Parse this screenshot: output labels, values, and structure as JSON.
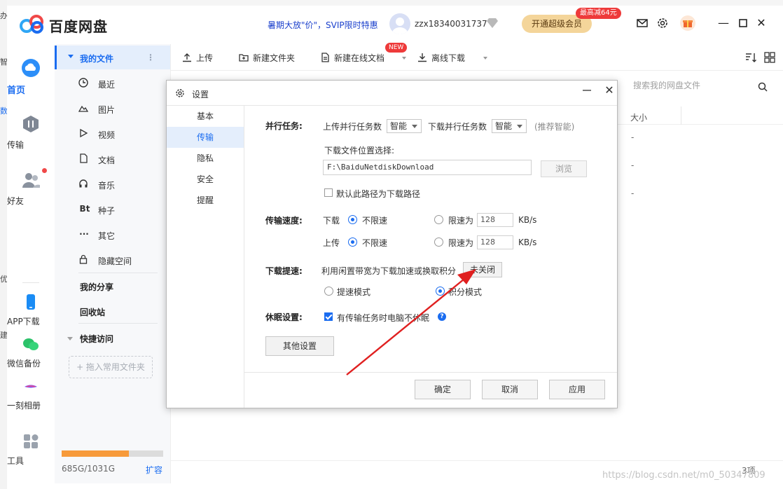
{
  "app": {
    "name": "百度网盘",
    "promo": "暑期大放\"价\"，SVIP限时特惠",
    "username": "zzx18340031737",
    "vip_button": "开通超级会员",
    "vip_badge": "最高减64元"
  },
  "rail": {
    "items": [
      {
        "label": "首页"
      },
      {
        "label": "传输"
      },
      {
        "label": "好友"
      },
      {
        "label": "APP下载"
      },
      {
        "label": "微信备份"
      },
      {
        "label": "一刻相册"
      },
      {
        "label": "工具"
      }
    ]
  },
  "tree": {
    "mine": "我的文件",
    "items": [
      {
        "label": "最近",
        "icon": "clock-icon"
      },
      {
        "label": "图片",
        "icon": "image-icon"
      },
      {
        "label": "视频",
        "icon": "play-icon"
      },
      {
        "label": "文档",
        "icon": "document-icon"
      },
      {
        "label": "音乐",
        "icon": "headphone-icon"
      },
      {
        "label": "种子",
        "icon": "bt-icon",
        "glyph": "Bt"
      },
      {
        "label": "其它",
        "icon": "more-icon",
        "glyph": "···"
      },
      {
        "label": "隐藏空间",
        "icon": "lock-icon"
      }
    ],
    "share": "我的分享",
    "recycle": "回收站",
    "quick_access": "快捷访问",
    "drag_hint": "+ 拖入常用文件夹",
    "storage_text": "685G/1031G",
    "storage_used_fraction": 0.664,
    "expand": "扩容"
  },
  "toolbar": {
    "upload": "上传",
    "new_folder": "新建文件夹",
    "new_doc": "新建在线文档",
    "new_badge": "NEW",
    "offline": "离线下载"
  },
  "main": {
    "search_placeholder": "搜索我的网盘文件",
    "col_size": "大小",
    "rows": [
      "-",
      "-",
      "-"
    ],
    "count": "3项"
  },
  "dialog": {
    "title": "设置",
    "nav": [
      {
        "label": "基本",
        "active": false
      },
      {
        "label": "传输",
        "active": true
      },
      {
        "label": "隐私",
        "active": false
      },
      {
        "label": "安全",
        "active": false
      },
      {
        "label": "提醒",
        "active": false
      }
    ],
    "parallel": {
      "label": "并行任务:",
      "upload_label": "上传并行任务数",
      "upload_value": "智能",
      "download_label": "下载并行任务数",
      "download_value": "智能",
      "hint": "(推荐智能)"
    },
    "download_path": {
      "label": "下载文件位置选择:",
      "value": "F:\\BaiduNetdiskDownload",
      "browse": "浏览",
      "default_check": "默认此路径为下载路径"
    },
    "speed": {
      "label": "传输速度:",
      "download": "下载",
      "upload": "上传",
      "unlimited": "不限速",
      "limit_to": "限速为",
      "download_limit": "128",
      "upload_limit": "128",
      "unit": "KB/s"
    },
    "boost": {
      "label": "下载提速:",
      "desc": "利用闲置带宽为下载加速或换取积分",
      "status_button": "未关闭",
      "mode_speed": "提速模式",
      "mode_points": "积分模式"
    },
    "sleep": {
      "label": "休眠设置:",
      "check": "有传输任务时电脑不休眠"
    },
    "other": "其他设置",
    "ok": "确定",
    "cancel": "取消",
    "apply": "应用"
  },
  "watermark": "https://blog.csdn.net/m0_50347809"
}
